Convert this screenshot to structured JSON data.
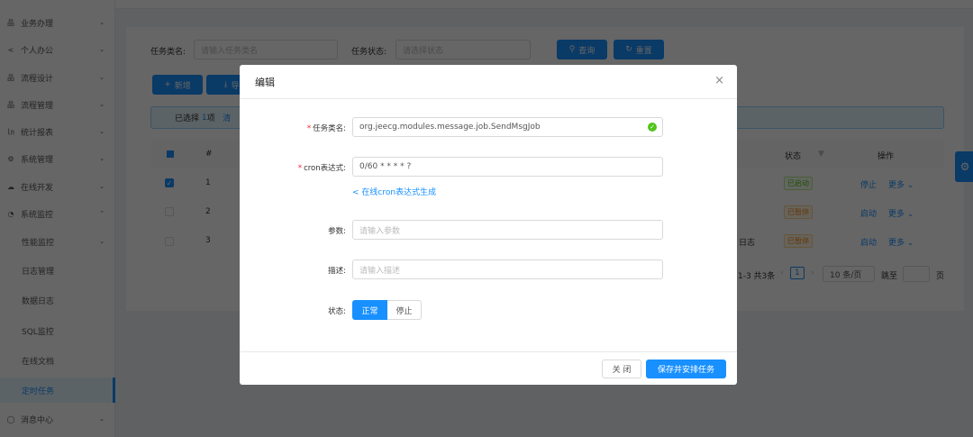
{
  "sidebar": {
    "items": [
      {
        "label": "业务办理",
        "icon": "apps-icon",
        "expand": "⌄"
      },
      {
        "label": "个人办公",
        "icon": "share-icon",
        "expand": "⌄"
      },
      {
        "label": "流程设计",
        "icon": "apps-icon",
        "expand": "⌄"
      },
      {
        "label": "流程管理",
        "icon": "apps-icon",
        "expand": "⌄"
      },
      {
        "label": "统计报表",
        "icon": "chart-icon",
        "expand": "⌄"
      },
      {
        "label": "系统管理",
        "icon": "gear-icon",
        "expand": "⌄"
      },
      {
        "label": "在线开发",
        "icon": "cloud-icon",
        "expand": "⌄"
      },
      {
        "label": "系统监控",
        "icon": "dashboard-icon",
        "expand": "⌃"
      },
      {
        "label": "性能监控",
        "expand": "⌄"
      },
      {
        "label": "日志管理"
      },
      {
        "label": "数据日志"
      },
      {
        "label": "SQL监控"
      },
      {
        "label": "在线文档"
      },
      {
        "label": "定时任务"
      },
      {
        "label": "消息中心",
        "icon": "message-icon",
        "expand": "⌄"
      }
    ],
    "active": "定时任务"
  },
  "search": {
    "name_label": "任务类名:",
    "name_placeholder": "请输入任务类名",
    "status_label": "任务状态:",
    "status_placeholder": "请选择状态",
    "query": "查询",
    "reset": "重置"
  },
  "toolbar": {
    "add": "新增",
    "export": "导"
  },
  "alert": {
    "prefix": "已选择",
    "count": "1",
    "suffix": "项",
    "clear": "清"
  },
  "table": {
    "headers": {
      "index": "#",
      "status": "状态",
      "actions": "操作"
    },
    "rows": [
      {
        "index": "1",
        "checked": true,
        "extra": "",
        "status": "已启动",
        "status_color": "green",
        "action": "停止",
        "more": "更多 ⌄"
      },
      {
        "index": "2",
        "checked": false,
        "extra": "",
        "status": "已暂停",
        "status_color": "orange",
        "action": "启动",
        "more": "更多 ⌄"
      },
      {
        "index": "3",
        "checked": false,
        "extra": "日志",
        "status": "已暂停",
        "status_color": "orange",
        "action": "启动",
        "more": "更多 ⌄"
      }
    ]
  },
  "pagination": {
    "total": "1-3 共3条",
    "page": "1",
    "size": "10 条/页",
    "jump": "跳至",
    "unit": "页"
  },
  "modal": {
    "title": "编辑",
    "close": "×",
    "class_label": "任务类名:",
    "class_value": "org.jeecg.modules.message.job.SendMsgJob",
    "cron_label": "cron表达式:",
    "cron_value": "0/60 * * * * ?",
    "cron_link": "在线cron表达式生成",
    "param_label": "参数:",
    "param_placeholder": "请输入参数",
    "desc_label": "描述:",
    "desc_placeholder": "请输入描述",
    "status_label": "状态:",
    "status_options": [
      "正常",
      "停止"
    ],
    "status_selected": "正常",
    "cancel": "关 闭",
    "submit": "保存并安排任务"
  },
  "colors": {
    "primary": "#1890ff",
    "success": "#52c41a",
    "warning": "#fa8c16",
    "required": "#f5222d"
  }
}
